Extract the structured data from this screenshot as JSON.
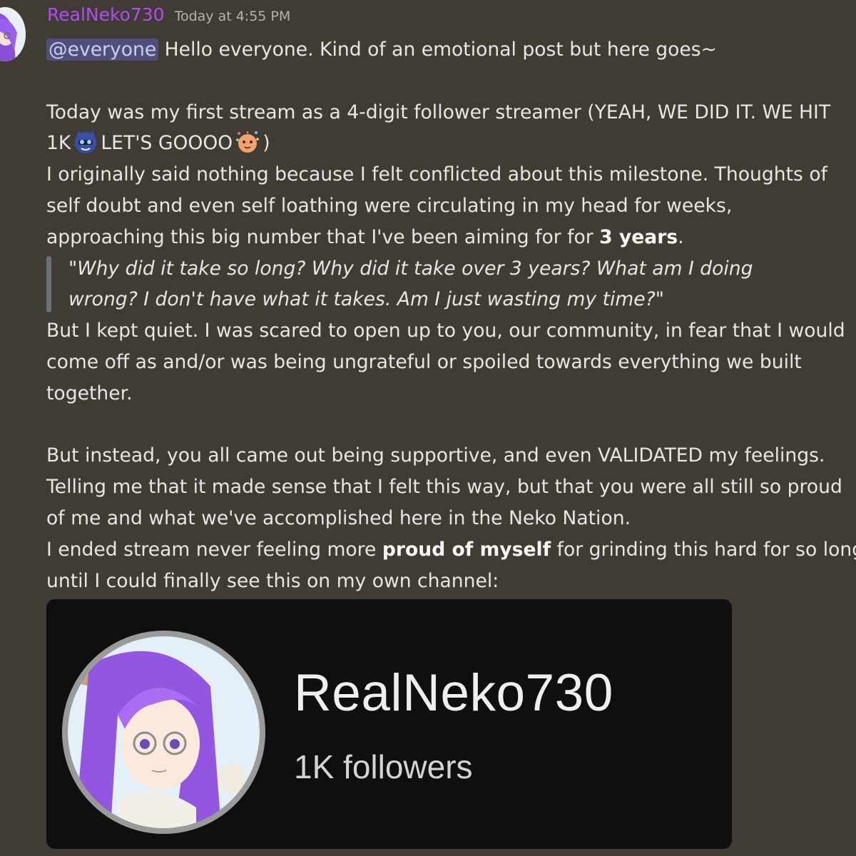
{
  "message": {
    "author": "RealNeko730",
    "timestamp": "Today at 4:55 PM",
    "mention": "@everyone",
    "line1_rest": " Hello everyone. Kind of an emotional post but here goes~",
    "p2_line1": "Today was my first stream as a 4-digit follower streamer (YEAH, WE DID IT. WE HIT",
    "p2_line2_a": "1K",
    "p2_line2_b": "LET'S GOOOO",
    "p2_line2_c": ")",
    "p3_line1": "I originally said nothing because I felt conflicted about this milestone. Thoughts of",
    "p3_line2": "self doubt and even self loathing were circulating in my head for weeks,",
    "p3_line3_a": "approaching this big number that I've been aiming for for ",
    "p3_line3_bold": "3 years",
    "p3_line3_c": ".",
    "quote_line1": "\"Why did it take so long? Why did it take over 3 years? What am I doing",
    "quote_line2": "wrong? I don't have what it takes. Am I just wasting my time?\"",
    "p4_line1": "But I kept quiet. I was scared to open up to you, our community, in fear that I would",
    "p4_line2": "come off as and/or was being ungrateful or spoiled towards everything we built",
    "p4_line3": "together.",
    "p5_line1": "But instead, you all came out being supportive, and even VALIDATED my feelings.",
    "p5_line2": "Telling me that it made sense that I felt this way, but that you were all still so proud",
    "p5_line3": "of me and what we've accomplished here in the Neko Nation.",
    "p6_line1_a": "I ended stream never feeling more ",
    "p6_line1_bold": "proud of myself",
    "p6_line1_c": " for grinding this hard for so long",
    "p6_line2": "until I could finally see this on my own channel:"
  },
  "attachment": {
    "channel_name": "RealNeko730",
    "followers": "1K followers"
  },
  "icons": {
    "emoji1": "cat-emote-icon",
    "emoji2": "party-emote-icon"
  },
  "colors": {
    "background": "#413b35",
    "username": "#b04cf0",
    "mention_bg": "#4f4f7a",
    "card_bg": "#0f0f0f"
  }
}
